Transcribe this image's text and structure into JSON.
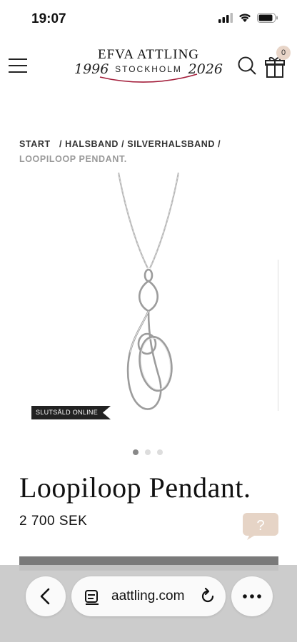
{
  "status": {
    "time": "19:07"
  },
  "brand": {
    "name": "EFVA ATTLING",
    "city": "STOCKHOLM",
    "year_start": "1996",
    "year_end": "2026"
  },
  "cart": {
    "count": "0"
  },
  "breadcrumb": {
    "start": "START",
    "halsband": "/ HALSBAND",
    "silverhalsband": "/ SILVERHALSBAND /",
    "current": "LOOPILOOP PENDANT."
  },
  "product": {
    "tag": "SLUTSÅLD ONLINE",
    "title": "Loopiloop Pendant.",
    "price": "2 700 SEK"
  },
  "gallery": {
    "total_images": 3,
    "active_index": 1
  },
  "help": {
    "symbol": "?"
  },
  "browser": {
    "url": "aattling.com"
  },
  "icons": {
    "menu": "hamburger-menu-icon",
    "search": "search-icon",
    "cart": "gift-icon",
    "back": "chevron-left-icon",
    "tabs": "tabs-icon",
    "reload": "reload-icon",
    "more": "more-dots-icon"
  },
  "colors": {
    "accent": "#a31d3a",
    "badge": "#e8d5c8",
    "help_bubble": "#e6d4c6",
    "buy_bar": "#7a7a7a"
  }
}
